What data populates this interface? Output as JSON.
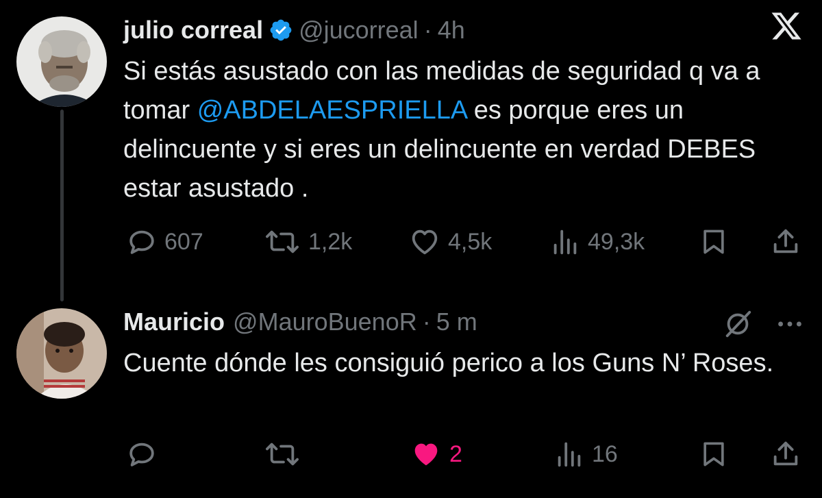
{
  "app": {
    "logo_icon": "x-logo-icon"
  },
  "tweets": [
    {
      "author": {
        "name": "julio correal",
        "handle": "@jucorreal",
        "verified": true,
        "avatar_icon": "avatar-man-gray-hair"
      },
      "separator": "·",
      "time": "4h",
      "text_parts": [
        "Si estás asustado con las medidas de seguridad q va a tomar ",
        "@ABDELAESPRIELLA",
        " es porque eres un delincuente y si eres un delincuente en verdad DEBES estar asustado ."
      ],
      "stats": {
        "replies": "607",
        "reposts": "1,2k",
        "likes": "4,5k",
        "views": "49,3k"
      }
    },
    {
      "author": {
        "name": "Mauricio",
        "handle": "@MauroBuenoR",
        "avatar_icon": "avatar-child-photo"
      },
      "separator": "·",
      "time": "5 m",
      "text": "Cuente dónde les consiguió perico a los Guns N’ Roses.",
      "stats": {
        "replies": "",
        "reposts": "",
        "likes": "2",
        "liked": true,
        "views": "16"
      }
    }
  ],
  "colors": {
    "background": "#000000",
    "text": "#e7e9ea",
    "muted": "#71767b",
    "link": "#1d9bf0",
    "like": "#f91880",
    "verified": "#1d9bf0"
  }
}
